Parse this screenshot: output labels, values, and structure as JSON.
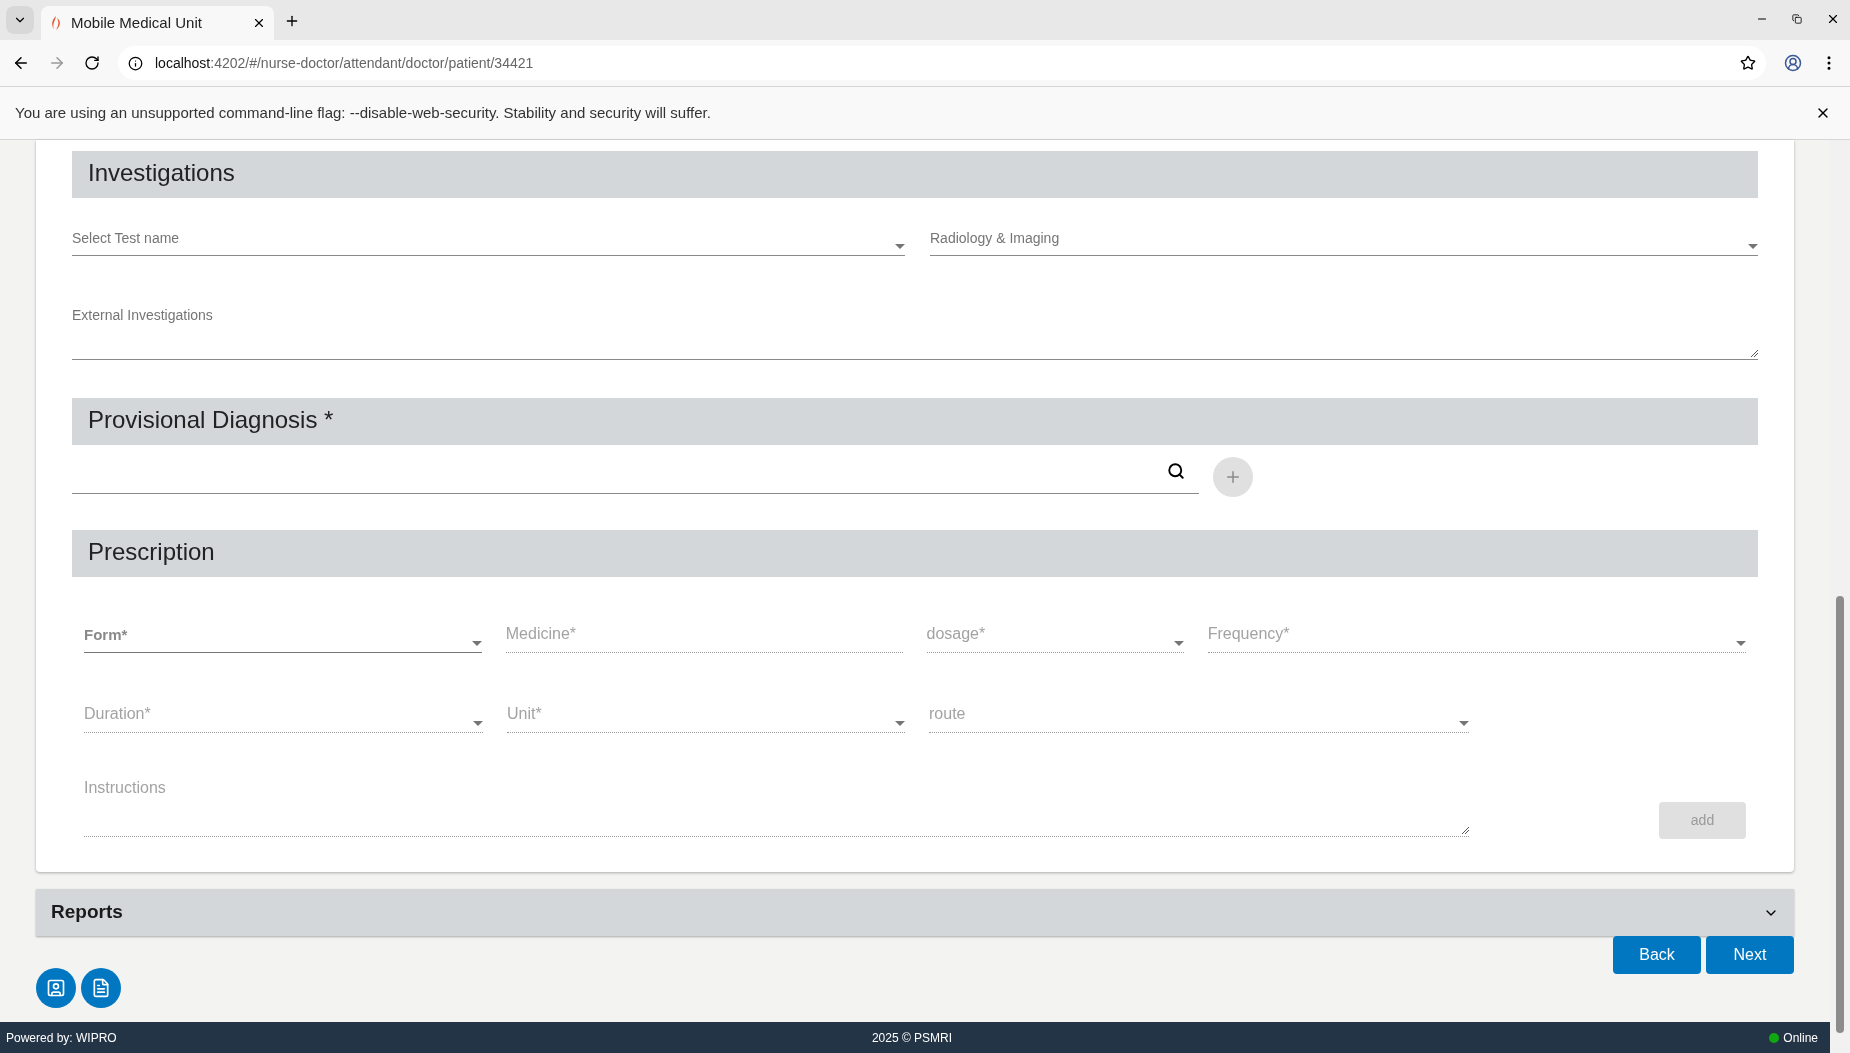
{
  "browser": {
    "tab_title": "Mobile Medical Unit",
    "url_host": "localhost",
    "url_path": ":4202/#/nurse-doctor/attendant/doctor/patient/34421"
  },
  "infobar": {
    "message": "You are using an unsupported command-line flag: --disable-web-security. Stability and security will suffer."
  },
  "investigations": {
    "title": "Investigations",
    "fields": [
      {
        "kind": "select",
        "label": "Select Test name"
      },
      {
        "kind": "select",
        "label": "Radiology & Imaging"
      },
      {
        "kind": "textarea",
        "label": "External Investigations"
      }
    ]
  },
  "provisional_diagnosis": {
    "title": "Provisional Diagnosis *"
  },
  "prescription": {
    "title": "Prescription",
    "rows": [
      {
        "fields": [
          {
            "kind": "select",
            "label": "Form*",
            "disabled": false
          },
          {
            "kind": "input",
            "label": "Medicine*",
            "disabled": true
          },
          {
            "kind": "select",
            "label": "dosage*",
            "disabled": true
          },
          {
            "kind": "select",
            "label": "Frequency*",
            "disabled": true
          }
        ]
      },
      {
        "fields": [
          {
            "kind": "select",
            "label": "Duration*",
            "disabled": true
          },
          {
            "kind": "select",
            "label": "Unit*",
            "disabled": true
          },
          {
            "kind": "select",
            "label": "route",
            "disabled": true
          }
        ]
      },
      {
        "fields": [
          {
            "kind": "textarea",
            "label": "Instructions",
            "disabled": true
          }
        ]
      }
    ],
    "add_button": "add"
  },
  "reports": {
    "title": "Reports",
    "expanded": false
  },
  "buttons": [
    "Back",
    "Next"
  ],
  "footer": {
    "powered_by": "Powered by: WIPRO",
    "copyright": "2025 © PSMRI",
    "status": {
      "label": "Online",
      "color": "#11a711"
    }
  }
}
